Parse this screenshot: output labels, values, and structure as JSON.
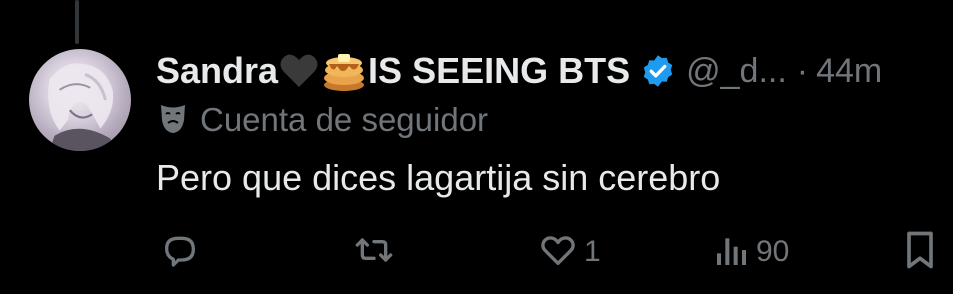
{
  "tweet": {
    "display_name": "Sandra",
    "display_name_suffix": "IS SEEING BTS",
    "emojis": [
      "black-heart",
      "pancakes"
    ],
    "verified": true,
    "verified_color": "#1d9bf0",
    "handle": "@_d...",
    "separator": "·",
    "time": "44m",
    "account_label": "Cuenta de seguidor",
    "account_label_icon": "theater-masks-icon",
    "text": "Pero que dices lagartija sin cerebro"
  },
  "actions": {
    "reply_count": "",
    "retweet_count": "",
    "like_count": "1",
    "views_count": "90"
  },
  "colors": {
    "background": "#000000",
    "primary_text": "#e7e9ea",
    "secondary_text": "#71767b",
    "verified_blue": "#1d9bf0"
  }
}
